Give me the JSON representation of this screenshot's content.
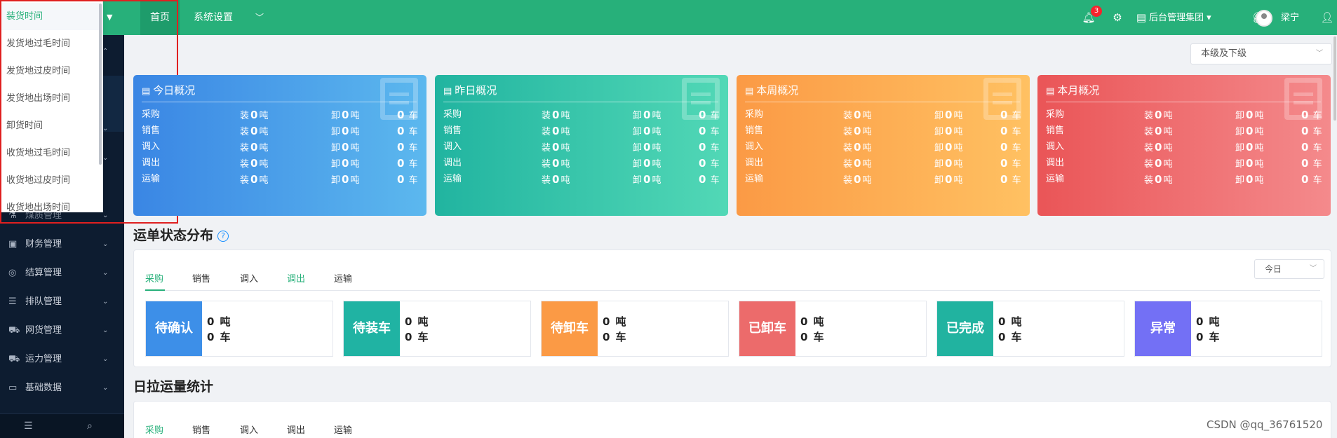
{
  "topbar": {
    "nav": [
      "首页",
      "系统设置"
    ],
    "notifications_count": "3",
    "org": "后台管理集团",
    "user": "梁宁"
  },
  "dropdown": {
    "options": [
      "装货时间",
      "发货地过毛时间",
      "发货地过皮时间",
      "发货地出场时间",
      "卸货时间",
      "收货地过毛时间",
      "收货地过皮时间",
      "收货地出场时间"
    ],
    "selected": "装货时间"
  },
  "sidebar": {
    "items": [
      "煤质管理",
      "财务管理",
      "结算管理",
      "排队管理",
      "网货管理",
      "运力管理",
      "基础数据"
    ]
  },
  "scope_select": {
    "value": "本级及下级"
  },
  "overview_cards": [
    {
      "title": "今日概况",
      "rows": [
        {
          "type": "采购",
          "load_label": "装",
          "load": "0",
          "unload_label": "卸",
          "unload": "0",
          "unit": "吨",
          "trucks": "0",
          "truck_unit": "车"
        },
        {
          "type": "销售",
          "load_label": "装",
          "load": "0",
          "unload_label": "卸",
          "unload": "0",
          "unit": "吨",
          "trucks": "0",
          "truck_unit": "车"
        },
        {
          "type": "调入",
          "load_label": "装",
          "load": "0",
          "unload_label": "卸",
          "unload": "0",
          "unit": "吨",
          "trucks": "0",
          "truck_unit": "车"
        },
        {
          "type": "调出",
          "load_label": "装",
          "load": "0",
          "unload_label": "卸",
          "unload": "0",
          "unit": "吨",
          "trucks": "0",
          "truck_unit": "车"
        },
        {
          "type": "运输",
          "load_label": "装",
          "load": "0",
          "unload_label": "卸",
          "unload": "0",
          "unit": "吨",
          "trucks": "0",
          "truck_unit": "车"
        }
      ]
    },
    {
      "title": "昨日概况",
      "rows": [
        {
          "type": "采购",
          "load_label": "装",
          "load": "0",
          "unload_label": "卸",
          "unload": "0",
          "unit": "吨",
          "trucks": "0",
          "truck_unit": "车"
        },
        {
          "type": "销售",
          "load_label": "装",
          "load": "0",
          "unload_label": "卸",
          "unload": "0",
          "unit": "吨",
          "trucks": "0",
          "truck_unit": "车"
        },
        {
          "type": "调入",
          "load_label": "装",
          "load": "0",
          "unload_label": "卸",
          "unload": "0",
          "unit": "吨",
          "trucks": "0",
          "truck_unit": "车"
        },
        {
          "type": "调出",
          "load_label": "装",
          "load": "0",
          "unload_label": "卸",
          "unload": "0",
          "unit": "吨",
          "trucks": "0",
          "truck_unit": "车"
        },
        {
          "type": "运输",
          "load_label": "装",
          "load": "0",
          "unload_label": "卸",
          "unload": "0",
          "unit": "吨",
          "trucks": "0",
          "truck_unit": "车"
        }
      ]
    },
    {
      "title": "本周概况",
      "rows": [
        {
          "type": "采购",
          "load_label": "装",
          "load": "0",
          "unload_label": "卸",
          "unload": "0",
          "unit": "吨",
          "trucks": "0",
          "truck_unit": "车"
        },
        {
          "type": "销售",
          "load_label": "装",
          "load": "0",
          "unload_label": "卸",
          "unload": "0",
          "unit": "吨",
          "trucks": "0",
          "truck_unit": "车"
        },
        {
          "type": "调入",
          "load_label": "装",
          "load": "0",
          "unload_label": "卸",
          "unload": "0",
          "unit": "吨",
          "trucks": "0",
          "truck_unit": "车"
        },
        {
          "type": "调出",
          "load_label": "装",
          "load": "0",
          "unload_label": "卸",
          "unload": "0",
          "unit": "吨",
          "trucks": "0",
          "truck_unit": "车"
        },
        {
          "type": "运输",
          "load_label": "装",
          "load": "0",
          "unload_label": "卸",
          "unload": "0",
          "unit": "吨",
          "trucks": "0",
          "truck_unit": "车"
        }
      ]
    },
    {
      "title": "本月概况",
      "rows": [
        {
          "type": "采购",
          "load_label": "装",
          "load": "0",
          "unload_label": "卸",
          "unload": "0",
          "unit": "吨",
          "trucks": "0",
          "truck_unit": "车"
        },
        {
          "type": "销售",
          "load_label": "装",
          "load": "0",
          "unload_label": "卸",
          "unload": "0",
          "unit": "吨",
          "trucks": "0",
          "truck_unit": "车"
        },
        {
          "type": "调入",
          "load_label": "装",
          "load": "0",
          "unload_label": "卸",
          "unload": "0",
          "unit": "吨",
          "trucks": "0",
          "truck_unit": "车"
        },
        {
          "type": "调出",
          "load_label": "装",
          "load": "0",
          "unload_label": "卸",
          "unload": "0",
          "unit": "吨",
          "trucks": "0",
          "truck_unit": "车"
        },
        {
          "type": "运输",
          "load_label": "装",
          "load": "0",
          "unload_label": "卸",
          "unload": "0",
          "unit": "吨",
          "trucks": "0",
          "truck_unit": "车"
        }
      ]
    }
  ],
  "status_section": {
    "title": "运单状态分布",
    "tabs": [
      "采购",
      "销售",
      "调入",
      "调出",
      "运输"
    ],
    "active_tab": "采购",
    "period": "今日",
    "statuses": [
      {
        "label": "待确认",
        "tons": "0",
        "ton_unit": "吨",
        "trucks": "0",
        "truck_unit": "车",
        "color": "#3d8fe8"
      },
      {
        "label": "待装车",
        "tons": "0",
        "ton_unit": "吨",
        "trucks": "0",
        "truck_unit": "车",
        "color": "#20b3a3"
      },
      {
        "label": "待卸车",
        "tons": "0",
        "ton_unit": "吨",
        "trucks": "0",
        "truck_unit": "车",
        "color": "#fb9a45"
      },
      {
        "label": "已卸车",
        "tons": "0",
        "ton_unit": "吨",
        "trucks": "0",
        "truck_unit": "车",
        "color": "#ec6b6b"
      },
      {
        "label": "已完成",
        "tons": "0",
        "ton_unit": "吨",
        "trucks": "0",
        "truck_unit": "车",
        "color": "#21b3a0"
      },
      {
        "label": "异常",
        "tons": "0",
        "ton_unit": "吨",
        "trucks": "0",
        "truck_unit": "车",
        "color": "#7370f5"
      }
    ]
  },
  "daily_section": {
    "title": "日拉运量统计",
    "tabs": [
      "采购",
      "销售",
      "调入",
      "调出",
      "运输"
    ]
  },
  "watermark": "CSDN @qq_36761520",
  "colors": {
    "brand": "#27b07a",
    "sidebar": "#0d1c30",
    "highlight_box": "#e02020"
  }
}
